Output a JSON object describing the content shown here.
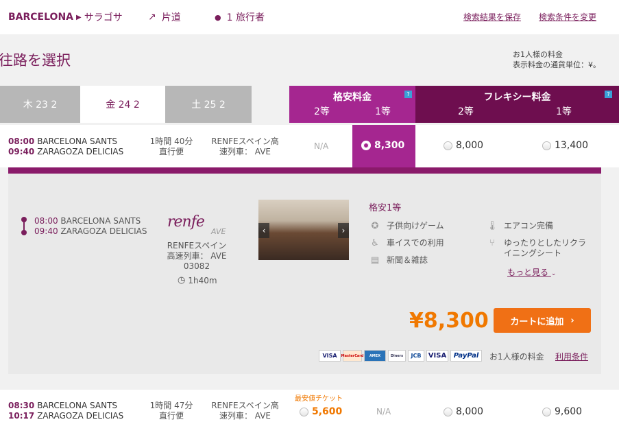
{
  "topbar": {
    "origin": "BARCELONA",
    "destination": "サラゴサ",
    "trip_type": "片道",
    "travelers": "1 旅行者",
    "save_results": "検索結果を保存",
    "change_search": "検索条件を変更"
  },
  "section": {
    "title": "往路を選択",
    "per_person": "お1人様の料金",
    "currency_note": "表示料金の通貨単位：¥。"
  },
  "date_tabs": [
    {
      "label": "木 23 2",
      "active": false
    },
    {
      "label": "金 24 2",
      "active": true
    },
    {
      "label": "土 25 2",
      "active": false
    }
  ],
  "fare_headers": {
    "economy": {
      "title": "格安料金",
      "class2": "2等",
      "class1": "1等",
      "help": "?"
    },
    "flexible": {
      "title": "フレキシー料金",
      "class2": "2等",
      "class1": "1等",
      "help": "?"
    }
  },
  "trains": [
    {
      "dep_time": "08:00",
      "dep_station": "BARCELONA SANTS",
      "arr_time": "09:40",
      "arr_station": "ZARAGOZA DELICIAS",
      "duration": "1時間 40分",
      "direct": "直行便",
      "train_line1": "RENFEスペイン高",
      "train_line2": "速列車： AVE",
      "econ2": "N/A",
      "econ1": "8,300",
      "flex2": "8,000",
      "flex1": "13,400"
    },
    {
      "dep_time": "08:30",
      "dep_station": "BARCELONA SANTS",
      "arr_time": "10:17",
      "arr_station": "ZARAGOZA DELICIAS",
      "duration": "1時間 47分",
      "direct": "直行便",
      "train_line1": "RENFEスペイン高",
      "train_line2": "速列車： AVE",
      "cheapest_label": "最安値チケット",
      "econ2": "5,600",
      "econ1": "N/A",
      "flex2": "8,000",
      "flex1": "9,600"
    }
  ],
  "detail": {
    "dep_time": "08:00",
    "dep_station": "BARCELONA SANTS",
    "arr_time": "09:40",
    "arr_station": "ZARAGOZA DELICIAS",
    "operator_logo": "renfe",
    "operator_sub": "AVE",
    "operator_line1": "RENFEスペイン",
    "operator_line2": "高速列車： AVE",
    "train_no": "03082",
    "duration": "1h40m",
    "class_title": "格安1等",
    "amenities": [
      {
        "icon": "game-icon",
        "label": "子供向けゲーム"
      },
      {
        "icon": "wheelchair-icon",
        "label": "車イスでの利用"
      },
      {
        "icon": "newspaper-icon",
        "label": "新聞＆雑誌"
      },
      {
        "icon": "thermometer-icon",
        "label": "エアコン完備"
      },
      {
        "icon": "seat-icon",
        "label": "ゆったりとしたリクライニングシート"
      }
    ],
    "more": "もっと見る",
    "price": "¥8,300",
    "add_to_cart": "カートに追加",
    "per_person": "お1人様の料金",
    "terms": "利用条件",
    "cards": [
      "VISA",
      "MasterCard",
      "AMEX",
      "Diners",
      "JCB",
      "VISA",
      "PayPal"
    ]
  },
  "colors": {
    "brand": "#7a1e5c",
    "economy": "#a52690",
    "flexible": "#6e0e4f",
    "accent": "#f07015"
  }
}
